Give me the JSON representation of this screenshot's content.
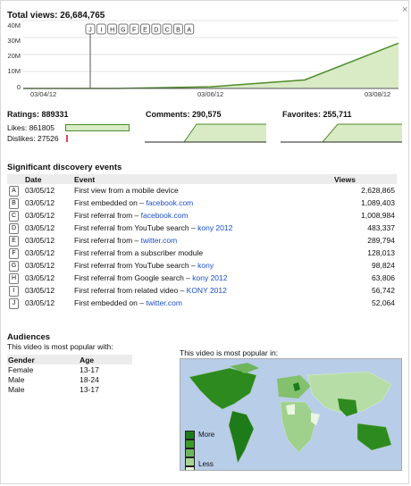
{
  "total_views": "Total views: 26,684,765",
  "close_icon": "×",
  "chart_data": {
    "type": "area",
    "x": [
      "03/04/12",
      "03/05/12",
      "03/06/12",
      "03/07/12",
      "03/08/12"
    ],
    "values": [
      0,
      0,
      1000000,
      5000000,
      26684765
    ],
    "ylim": [
      0,
      40000000
    ],
    "yticks": [
      "40M",
      "30M",
      "20M",
      "10M",
      "0"
    ],
    "xticks": [
      "03/04/12",
      "03/06/12",
      "03/08/12"
    ],
    "markers": [
      "J",
      "I",
      "H",
      "G",
      "F",
      "E",
      "D",
      "C",
      "B",
      "A"
    ]
  },
  "metrics": {
    "ratings": "Ratings: 889331",
    "likes": "Likes: 861805",
    "dislikes": "Dislikes: 27526",
    "comments": "Comments: 290,575",
    "favorites": "Favorites: 255,711"
  },
  "discovery": {
    "title": "Significant discovery events",
    "headers": [
      "Date",
      "Event",
      "Views"
    ],
    "rows": [
      {
        "id": "A",
        "date": "03/05/12",
        "event": "First view from a mobile device",
        "link": "",
        "views": "2,628,865"
      },
      {
        "id": "B",
        "date": "03/05/12",
        "event": "First embedded on – ",
        "link": "facebook.com",
        "views": "1,089,403"
      },
      {
        "id": "C",
        "date": "03/05/12",
        "event": "First referral from – ",
        "link": "facebook.com",
        "views": "1,008,984"
      },
      {
        "id": "D",
        "date": "03/05/12",
        "event": "First referral from YouTube search – ",
        "link": "kony 2012",
        "views": "483,337"
      },
      {
        "id": "E",
        "date": "03/05/12",
        "event": "First referral from – ",
        "link": "twitter.com",
        "views": "289,794"
      },
      {
        "id": "F",
        "date": "03/05/12",
        "event": "First referral from a subscriber module",
        "link": "",
        "views": "128,013"
      },
      {
        "id": "G",
        "date": "03/05/12",
        "event": "First referral from YouTube search – ",
        "link": "kony",
        "views": "98,824"
      },
      {
        "id": "H",
        "date": "03/05/12",
        "event": "First referral from Google search – ",
        "link": "kony 2012",
        "views": "63,806"
      },
      {
        "id": "I",
        "date": "03/05/12",
        "event": "First referral from related video – ",
        "link": "KONY 2012",
        "views": "56,742"
      },
      {
        "id": "J",
        "date": "03/05/12",
        "event": "First embedded on – ",
        "link": "twitter.com",
        "views": "52,064"
      }
    ]
  },
  "audiences": {
    "title": "Audiences",
    "popular_with": "This video is most popular with:",
    "headers": [
      "Gender",
      "Age"
    ],
    "rows": [
      {
        "gender": "Female",
        "age": "13-17"
      },
      {
        "gender": "Male",
        "age": "18-24"
      },
      {
        "gender": "Male",
        "age": "13-17"
      }
    ],
    "popular_in": "This video is most popular in:",
    "legend_more": "More",
    "legend_less": "Less"
  },
  "colors": {
    "line": "#4f8c2c",
    "fill": "#d8ebc5",
    "map_dark": "#2d8a1f",
    "map_light": "#d9efc8"
  }
}
